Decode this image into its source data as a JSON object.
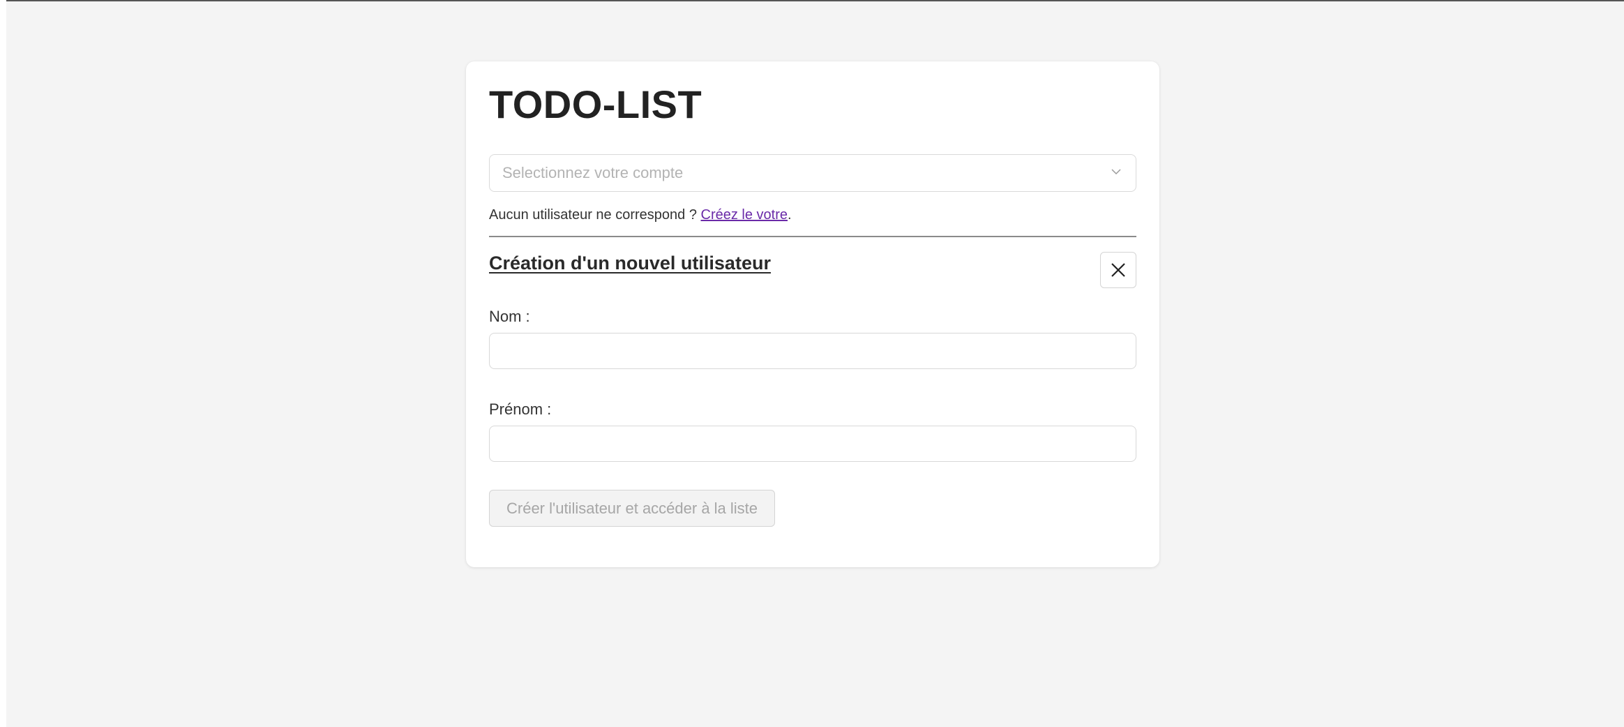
{
  "app": {
    "title": "TODO-LIST"
  },
  "account_select": {
    "placeholder": "Selectionnez votre compte",
    "icon": "chevron-down-icon"
  },
  "hint": {
    "text": "Aucun utilisateur ne correspond ? ",
    "link": "Créez le votre",
    "suffix": "."
  },
  "new_user_form": {
    "title": "Création d'un nouvel utilisateur",
    "close_icon": "close-icon",
    "nom_label": "Nom :",
    "nom_value": "",
    "prenom_label": "Prénom :",
    "prenom_value": "",
    "submit_label": "Créer l'utilisateur et accéder à la liste",
    "submit_enabled": false
  },
  "colors": {
    "page_background": "#f4f4f4",
    "card_background": "#ffffff",
    "link": "#6a2aa8",
    "title_text": "#222222",
    "disabled_text": "#a6a6a6"
  }
}
